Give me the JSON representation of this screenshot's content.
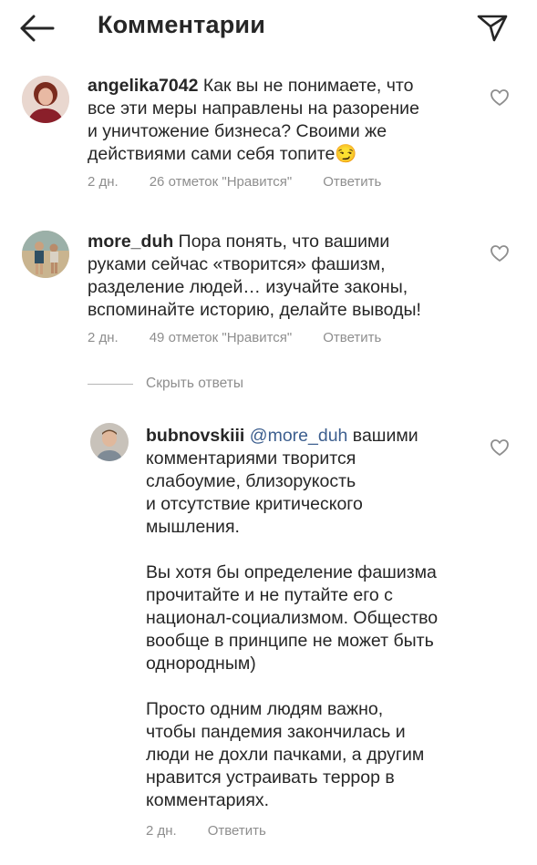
{
  "header": {
    "title": "Комментарии",
    "back_icon": "arrow-left-icon",
    "send_icon": "paper-plane-icon"
  },
  "comments": [
    {
      "username": "angelika7042",
      "text_first": " Как вы не понимаете, что",
      "lines": [
        "все эти меры направлены на разорение",
        "и уничтожение бизнеса? Своими же",
        "действиями сами себя топите😏"
      ],
      "time": "2 дн.",
      "likes": "26 отметок \"Нравится\"",
      "reply": "Ответить"
    },
    {
      "username": "more_duh",
      "text_first": " Пора понять, что вашими",
      "lines": [
        "руками сейчас «творится» фашизм,",
        "разделение людей… изучайте законы,",
        "вспоминайте историю, делайте выводы!"
      ],
      "time": "2 дн.",
      "likes": "49 отметок \"Нравится\"",
      "reply": "Ответить"
    }
  ],
  "hide_replies": "Скрыть ответы",
  "reply_comment": {
    "username": "bubnovskiii",
    "mention": "@more_duh",
    "text_first": " вашими",
    "lines": [
      "комментариями творится",
      "слабоумие, близорукость",
      "и отсутствие критического",
      "мышления.",
      "",
      "Вы хотя бы определение фашизма",
      "прочитайте и не путайте его с",
      "национал-социализмом. Общество",
      "вообще в принципе не может быть",
      "однородным)",
      "",
      "Просто одним людям важно,",
      "чтобы пандемия закончилась и",
      "люди не дохли пачками, а другим",
      "нравится устраивать террор в",
      "комментариях."
    ],
    "time": "2 дн.",
    "reply": "Ответить"
  },
  "colors": {
    "text": "#262626",
    "secondary": "#8e8e8e",
    "mention": "#3d5f8f"
  }
}
